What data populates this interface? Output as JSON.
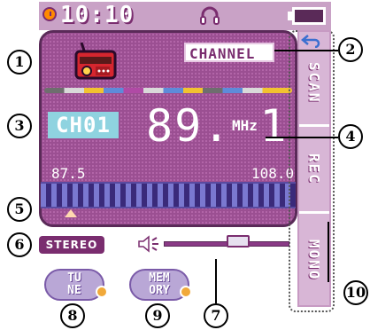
{
  "status_bar": {
    "time": "10:10",
    "icons": [
      "clock-icon",
      "headphones-icon",
      "battery-icon"
    ]
  },
  "radio": {
    "channel_label": "CHANNEL",
    "channel_badge": "CH01",
    "frequency": "89. 1",
    "unit": "MHz",
    "range_min": "87.5",
    "range_max": "108.0",
    "tuning_position": 0.1
  },
  "side_menu": {
    "items": [
      {
        "label": "SCAN"
      },
      {
        "label": "REC"
      },
      {
        "label": "MONO"
      }
    ]
  },
  "audio": {
    "stereo_label": "STEREO",
    "volume_level": 0.57
  },
  "buttons": {
    "tune": "TU\nNE",
    "memory": "MEM\nORY"
  },
  "callouts": {
    "c1": "1",
    "c2": "2",
    "c3": "3",
    "c4": "4",
    "c5": "5",
    "c6": "6",
    "c7": "7",
    "c8": "8",
    "c9": "9",
    "c10": "10"
  },
  "colors": {
    "panel": "#9b4f92",
    "accent": "#7a2d6f",
    "badge": "#8fd3e0",
    "tuning_bar": "#3a2a7a"
  }
}
